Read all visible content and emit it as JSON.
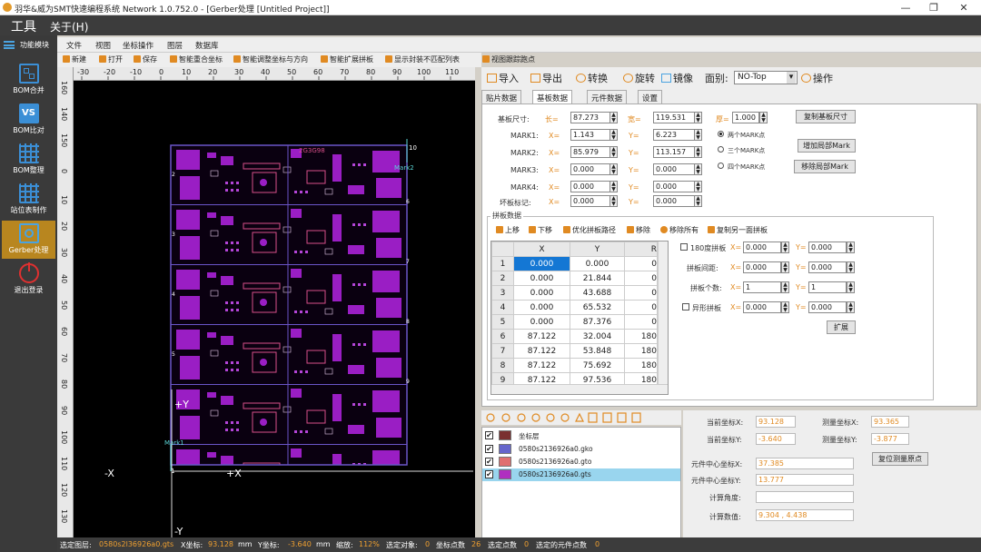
{
  "window": {
    "title": "羽华&威为SMT快速编程系统 Network  1.0.752.0 - [Gerber处理 [Untitled Project]]"
  },
  "menubar": {
    "tools": "工具",
    "about": "关于(H)"
  },
  "sidebar": {
    "header": "功能模块",
    "items": [
      {
        "label": "BOM合并",
        "icon": "grid-icon"
      },
      {
        "label": "BOM比对",
        "icon": "vs-icon"
      },
      {
        "label": "BOM整理",
        "icon": "table-icon"
      },
      {
        "label": "站位表制作",
        "icon": "table-icon"
      },
      {
        "label": "Gerber处理",
        "icon": "circuit-icon"
      },
      {
        "label": "退出登录",
        "icon": "power-icon"
      }
    ]
  },
  "menu2": [
    "文件",
    "视图",
    "坐标操作",
    "图层",
    "数据库"
  ],
  "toolbar": [
    "新建",
    "打开",
    "保存",
    "智能重合坐标",
    "智能调整坐标与方向",
    "智能扩展拼板",
    "显示封装不匹配列表",
    "视图跟踪跑点"
  ],
  "ruler_top": [
    "-30",
    "-20",
    "-10",
    "0",
    "10",
    "20",
    "30",
    "40",
    "50",
    "60",
    "70",
    "80",
    "90",
    "100",
    "110"
  ],
  "ruler_unit": "mm",
  "ruler_left": [
    "0",
    "10",
    "20",
    "30",
    "40",
    "50",
    "60",
    "70",
    "80",
    "90",
    "100",
    "110",
    "120",
    "130",
    "140",
    "150",
    "160"
  ],
  "canvas": {
    "axis_x_neg": "-X",
    "axis_x_pos": "+X",
    "axis_y_pos": "+Y",
    "axis_y_neg": "-Y",
    "mark1": "Mark1",
    "mark2": "Mark2",
    "label_10": "10",
    "label_1": "1",
    "board_id": "2G3G98",
    "row_nums": [
      "2",
      "3",
      "4",
      "5",
      "6",
      "7",
      "8",
      "9"
    ]
  },
  "right_toolbar": {
    "import": "导入",
    "export": "导出",
    "convert": "转换",
    "rotate": "旋转",
    "mirror": "镜像",
    "face_label": "面别:",
    "face_value": "NO-Top",
    "operate": "操作"
  },
  "tabs": [
    "贴片数据",
    "基板数据",
    "元件数据",
    "设置"
  ],
  "board": {
    "size_label": "基板尺寸:",
    "length_label": "长=",
    "width_label": "宽=",
    "thick_label": "厚=",
    "length": "87.273",
    "width": "119.531",
    "thick": "1.000",
    "copy_btn": "复制基板尺寸",
    "marks": [
      {
        "label": "MARK1:",
        "x": "1.143",
        "y": "6.223"
      },
      {
        "label": "MARK2:",
        "x": "85.979",
        "y": "113.157"
      },
      {
        "label": "MARK3:",
        "x": "0.000",
        "y": "0.000"
      },
      {
        "label": "MARK4:",
        "x": "0.000",
        "y": "0.000"
      },
      {
        "label": "坏板标记:",
        "x": "0.000",
        "y": "0.000"
      }
    ],
    "x_label": "X=",
    "y_label": "Y=",
    "radio": [
      "两个MARK点",
      "三个MARK点",
      "四个MARK点"
    ],
    "add_local_mark": "增加局部Mark",
    "remove_local_mark": "移除局部Mark"
  },
  "panel": {
    "title": "拼板数据",
    "tools": [
      "上移",
      "下移",
      "优化拼板路径",
      "移除",
      "移除所有",
      "复制另一面拼板"
    ],
    "columns": [
      "X",
      "Y",
      "R"
    ],
    "rows": [
      [
        "1",
        "0.000",
        "0.000",
        "0"
      ],
      [
        "2",
        "0.000",
        "21.844",
        "0"
      ],
      [
        "3",
        "0.000",
        "43.688",
        "0"
      ],
      [
        "4",
        "0.000",
        "65.532",
        "0"
      ],
      [
        "5",
        "0.000",
        "87.376",
        "0"
      ],
      [
        "6",
        "87.122",
        "32.004",
        "180"
      ],
      [
        "7",
        "87.122",
        "53.848",
        "180"
      ],
      [
        "8",
        "87.122",
        "75.692",
        "180"
      ],
      [
        "9",
        "87.122",
        "97.536",
        "180"
      ]
    ],
    "rot180": "180度拼板",
    "spacing": "拼板间距:",
    "count": "拼板个数:",
    "irregular": "异形拼板",
    "x_label": "X=",
    "y_label": "Y=",
    "rot_x": "0.000",
    "rot_y": "0.000",
    "sp_x": "0.000",
    "sp_y": "0.000",
    "cnt_x": "1",
    "cnt_y": "1",
    "irr_x": "0.000",
    "irr_y": "0.000",
    "extend_btn": "扩展"
  },
  "layers": [
    {
      "name": "坐标层",
      "color": "#7a3030",
      "checked": true
    },
    {
      "name": "0580s2136926a0.gko",
      "color": "#6666cc",
      "checked": true
    },
    {
      "name": "0580s2136926a0.gto",
      "color": "#e07070",
      "checked": true
    },
    {
      "name": "0580s2136926a0.gts",
      "color": "#b030c0",
      "checked": true
    }
  ],
  "coords": {
    "cur_x_label": "当前坐标X:",
    "cur_x": "93.128",
    "cur_y_label": "当前坐标Y:",
    "cur_y": "-3.640",
    "meas_x_label": "测量坐标X:",
    "meas_x": "93.365",
    "meas_y_label": "测量坐标Y:",
    "meas_y": "-3.877",
    "reset_btn": "复位测量原点",
    "center_x_label": "元件中心坐标X:",
    "center_x": "37.385",
    "center_y_label": "元件中心坐标Y:",
    "center_y": "13.777",
    "angle_label": "计算角度:",
    "angle": "",
    "calc_label": "计算数值:",
    "calc": "9.304 , 4.438"
  },
  "status": {
    "layer_label": "选定图层:",
    "layer": "0580s2l36926a0.gts",
    "x_label": "X坐标:",
    "x": "93.128",
    "unit1": "mm",
    "y_label": "Y坐标:",
    "y": "-3.640",
    "unit2": "mm",
    "zoom_label": "缩放:",
    "zoom": "112%",
    "sel_label": "选定对象:",
    "sel": "0",
    "pts_label": "坐标点数",
    "pts": "26",
    "sel_pts_label": "选定点数",
    "sel_pts": "0",
    "sel_comp_label": "选定的元件点数",
    "sel_comp": "0"
  }
}
